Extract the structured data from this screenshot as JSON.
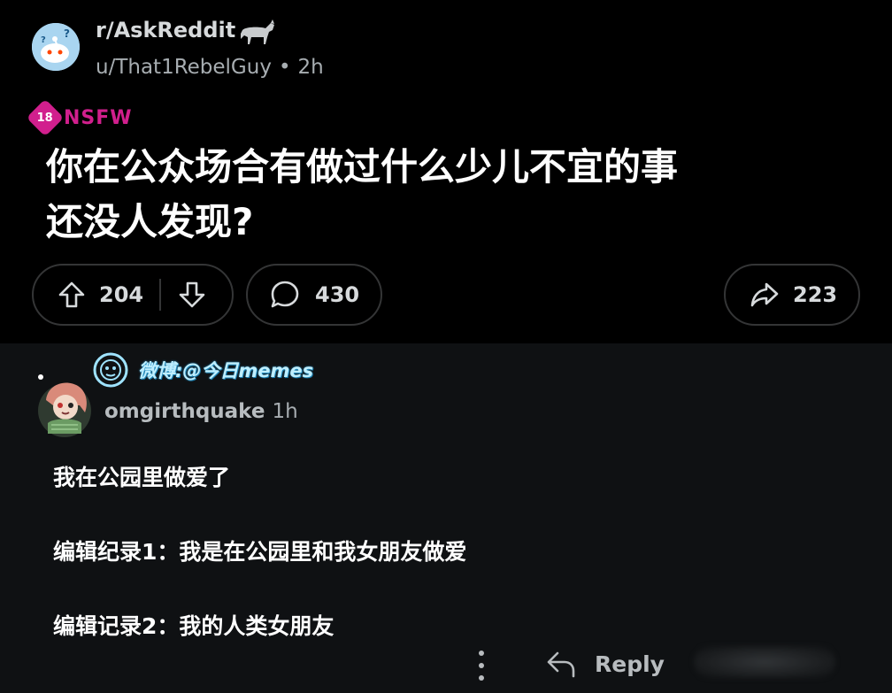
{
  "post": {
    "subreddit": "r/AskReddit",
    "author": "u/That1RebelGuy",
    "separator": "•",
    "age": "2h",
    "nsfw_badge": "18",
    "nsfw_label": "NSFW",
    "title_line1": "你在公众场合有做过什么少儿不宜的事",
    "title_line2": "还没人发现?",
    "upvotes": "204",
    "comments": "430",
    "shares": "223"
  },
  "watermark": {
    "text": "微博:@今日memes"
  },
  "comment": {
    "author": "omgirthquake",
    "age": "1h",
    "lines": [
      "我在公园里做爱了",
      "编辑纪录1：我是在公园里和我女朋友做爱",
      "编辑记录2：我的人类女朋友"
    ],
    "reply_label": "Reply"
  },
  "icons": {
    "upvote": "arrow-up-icon",
    "downvote": "arrow-down-icon",
    "comments": "speech-bubble-icon",
    "share": "share-arrow-icon",
    "reply": "reply-arrow-icon",
    "more": "vertical-dots-icon"
  },
  "colors": {
    "background": "#000000",
    "comment_background": "#0f1113",
    "nsfw": "#d11f8d",
    "text_primary": "#ffffff",
    "text_secondary": "#a7adb1",
    "border": "#343536"
  }
}
